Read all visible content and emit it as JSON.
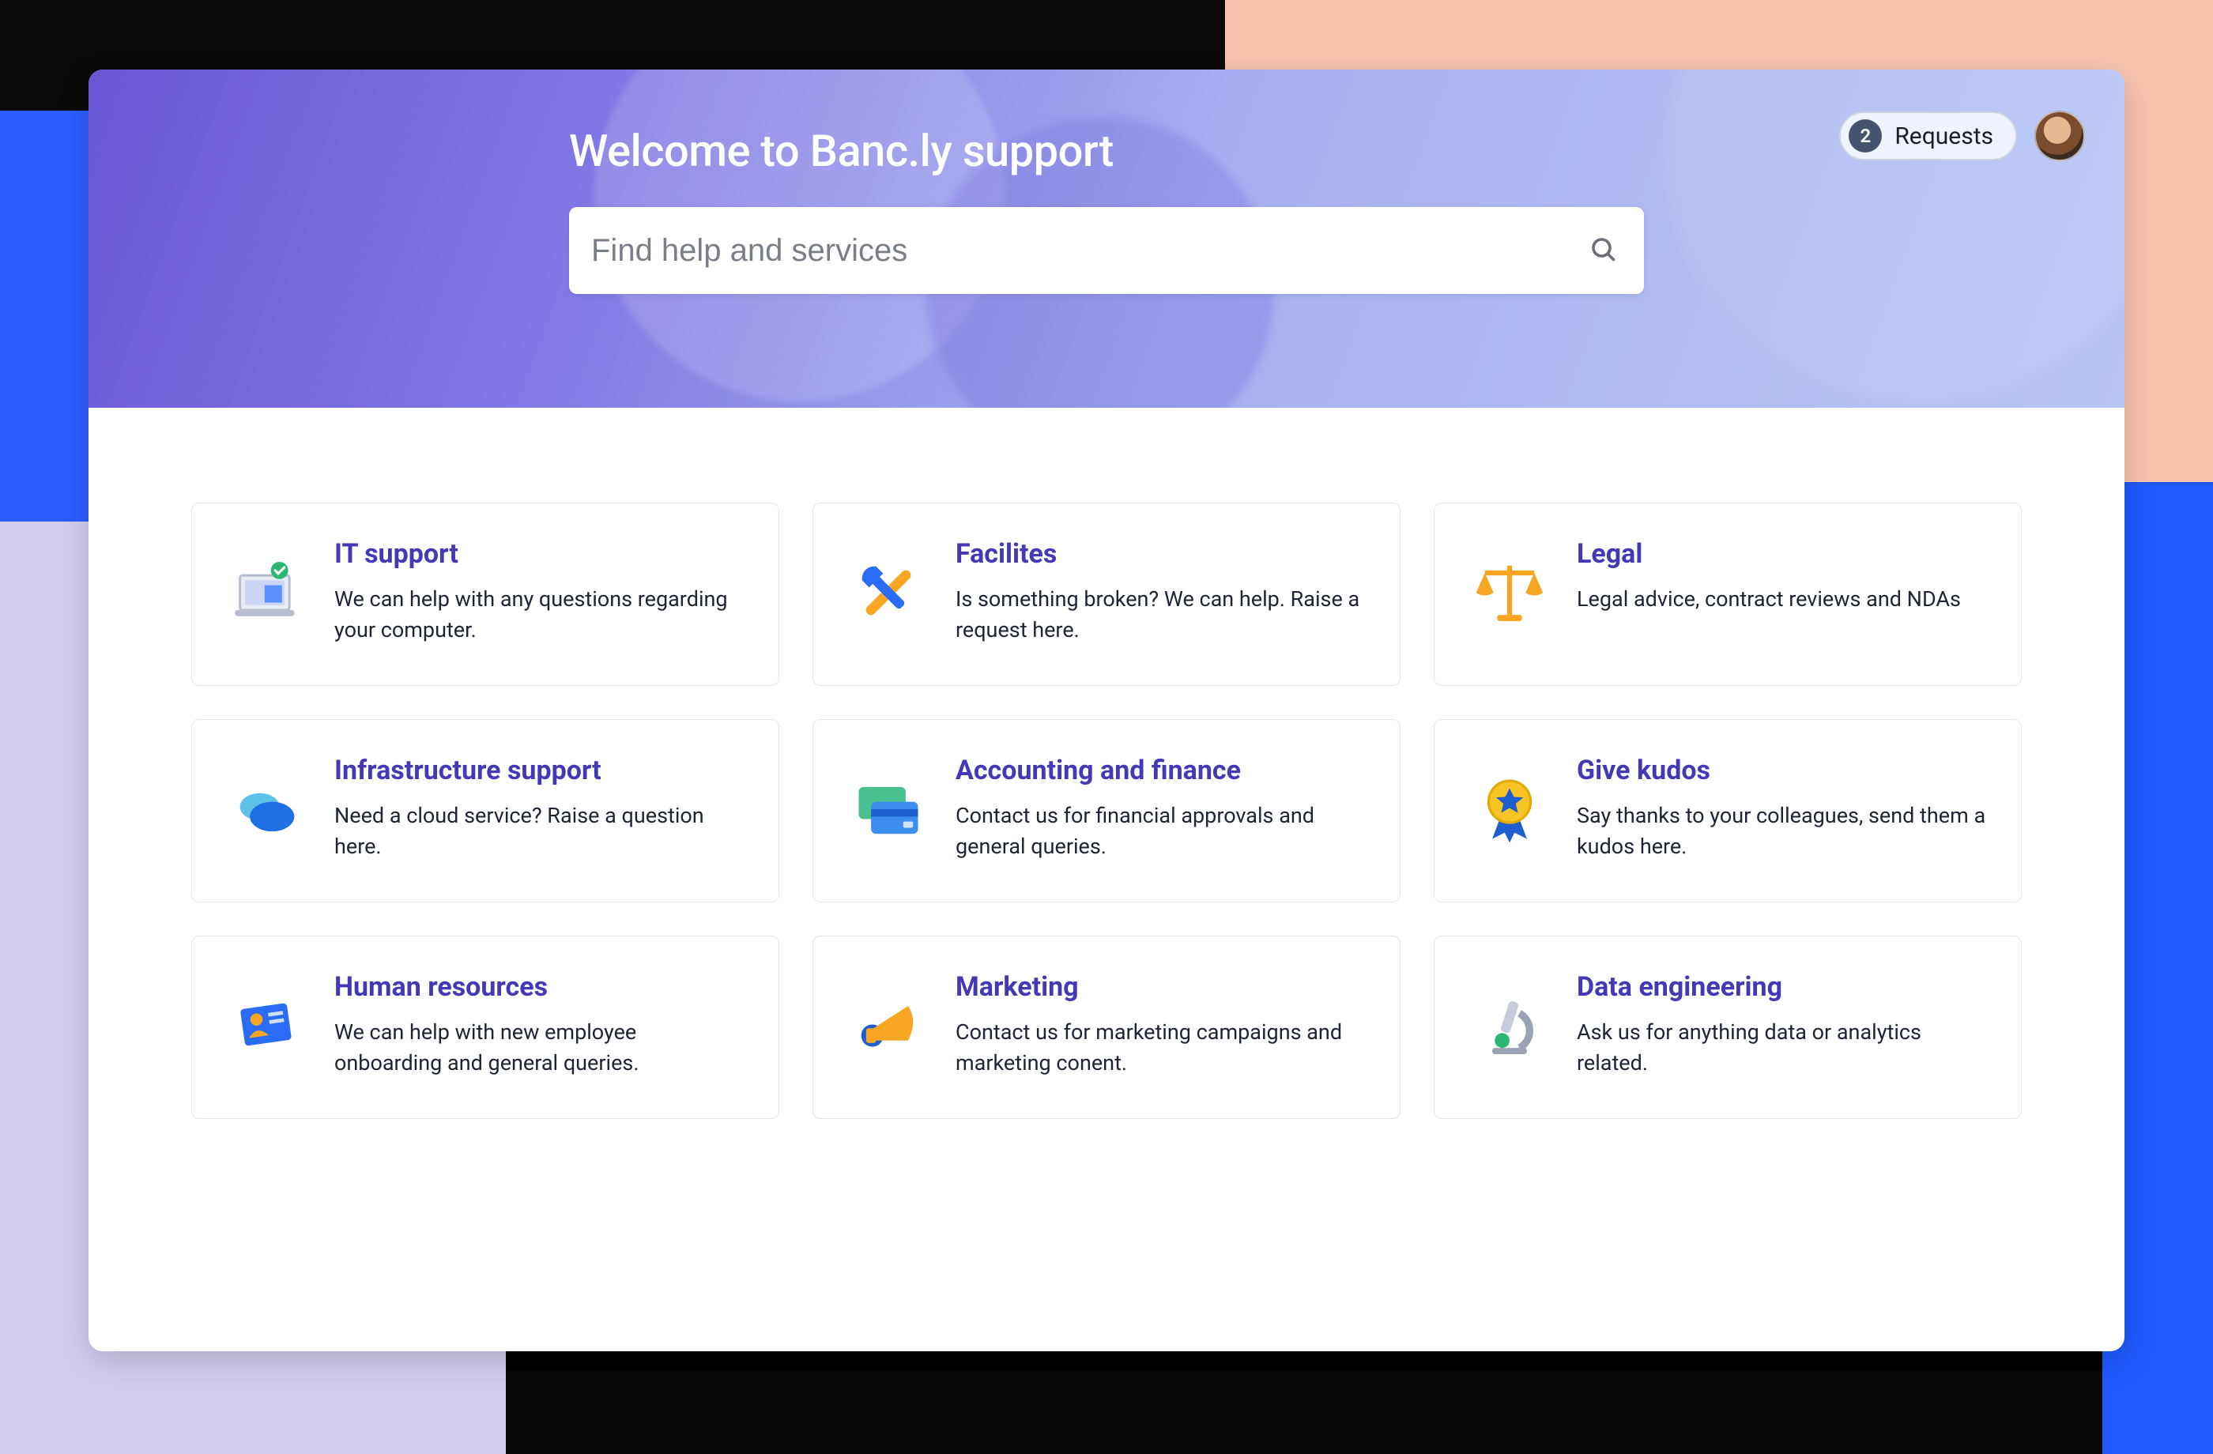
{
  "header": {
    "title": "Welcome to Banc.ly support",
    "search_placeholder": "Find help and services",
    "requests_count": "2",
    "requests_label": "Requests"
  },
  "cards": [
    {
      "title": "IT support",
      "desc": "We can help with any questions regarding your computer."
    },
    {
      "title": "Facilites",
      "desc": "Is something broken? We can help. Raise a request here."
    },
    {
      "title": "Legal",
      "desc": "Legal advice, contract reviews and NDAs"
    },
    {
      "title": "Infrastructure support",
      "desc": "Need a cloud service? Raise a question here."
    },
    {
      "title": "Accounting and finance",
      "desc": "Contact us for financial approvals and general queries."
    },
    {
      "title": "Give kudos",
      "desc": "Say thanks to your colleagues, send them a kudos here."
    },
    {
      "title": "Human resources",
      "desc": "We can help with new employee onboarding and general queries."
    },
    {
      "title": "Marketing",
      "desc": "Contact us for marketing campaigns and marketing conent."
    },
    {
      "title": "Data engineering",
      "desc": "Ask us for anything data or analytics related."
    }
  ]
}
